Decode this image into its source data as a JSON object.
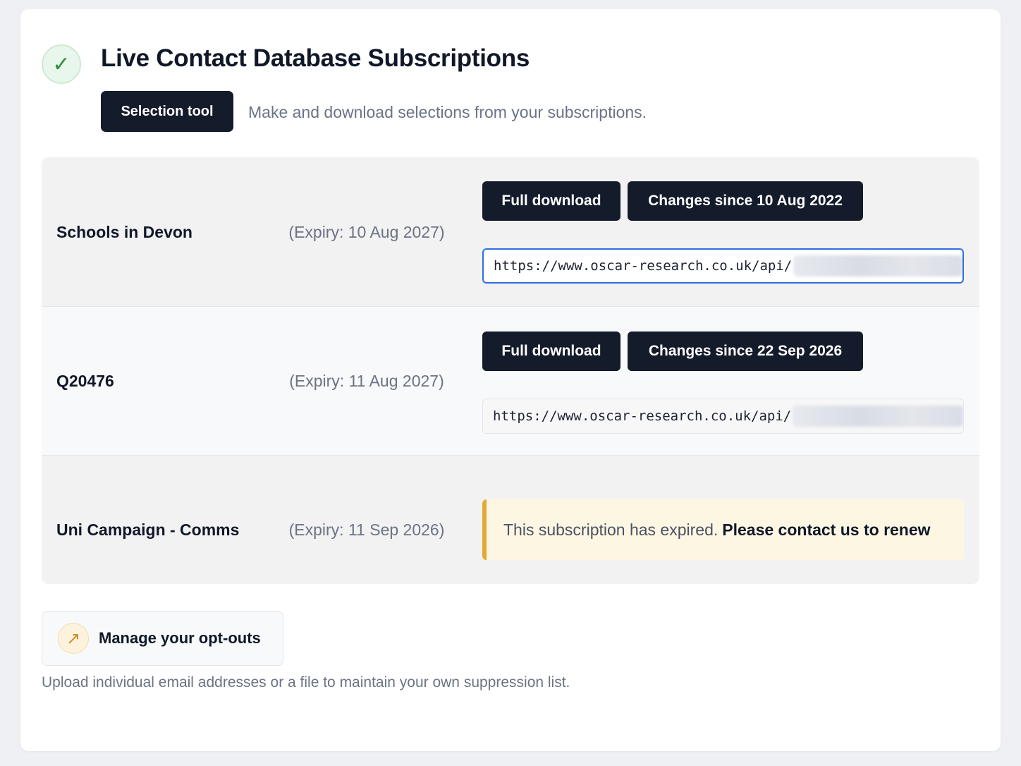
{
  "header": {
    "icon": "check-icon",
    "icon_glyph": "✓",
    "title": "Live Contact Database Subscriptions",
    "selection_tool_label": "Selection tool",
    "selection_tool_desc": "Make and download selections from your subscriptions."
  },
  "subscriptions": [
    {
      "name": "Schools in Devon",
      "expiry": "(Expiry: 10 Aug 2027)",
      "full_download_label": "Full download",
      "changes_label": "Changes since 10 Aug 2022",
      "url": "https://www.oscar-research.co.uk/api/"
    },
    {
      "name": "Q20476",
      "expiry": "(Expiry: 11 Aug 2027)",
      "full_download_label": "Full download",
      "changes_label": "Changes since 22 Sep 2026",
      "url": "https://www.oscar-research.co.uk/api/"
    },
    {
      "name": "Uni Campaign - Comms",
      "expiry": "(Expiry: 11 Sep 2026)",
      "expired_text": "This subscription has expired.",
      "renew_text": "Please contact us to renew"
    }
  ],
  "optouts": {
    "icon": "arrow-up-right-icon",
    "icon_glyph": "↗",
    "label": "Manage your opt-outs",
    "desc": "Upload individual email addresses or a file to maintain your own suppression list."
  },
  "colors": {
    "primary_button": "#141b2b",
    "url_focus_border": "#2f6fe0",
    "expired_accent": "#e0aa34",
    "success_icon": "#27903f"
  }
}
